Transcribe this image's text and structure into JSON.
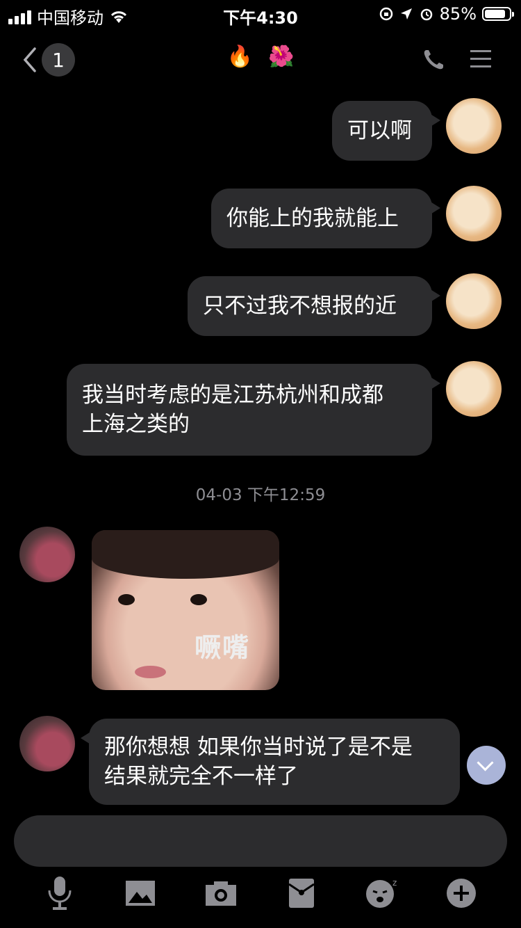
{
  "status_bar": {
    "carrier": "中国移动",
    "time": "下午4:30",
    "battery_text": "85%",
    "battery_level": 0.85
  },
  "header": {
    "unread_count": "1",
    "title_emojis": [
      "🔥",
      "🌺"
    ]
  },
  "messages": [
    {
      "side": "right",
      "text": "可以啊"
    },
    {
      "side": "right",
      "text": "你能上的我就能上"
    },
    {
      "side": "right",
      "text": "只不过我不想报的近"
    },
    {
      "side": "right",
      "text_line1": "我当时考虑的是江苏杭州和成都",
      "text_line2": "上海之类的"
    },
    {
      "side": "left",
      "type": "sticker",
      "caption": "噘嘴"
    },
    {
      "side": "left",
      "text_line1": "那你想想 如果你当时说了是不是",
      "text_line2": "结果就完全不一样了"
    }
  ],
  "timestamp": "04-03 下午12:59",
  "icons": {
    "voice": "microphone-icon",
    "image": "image-icon",
    "camera": "camera-icon",
    "red_packet": "red-packet-icon",
    "emoji": "emoji-icon",
    "more": "plus-icon"
  }
}
